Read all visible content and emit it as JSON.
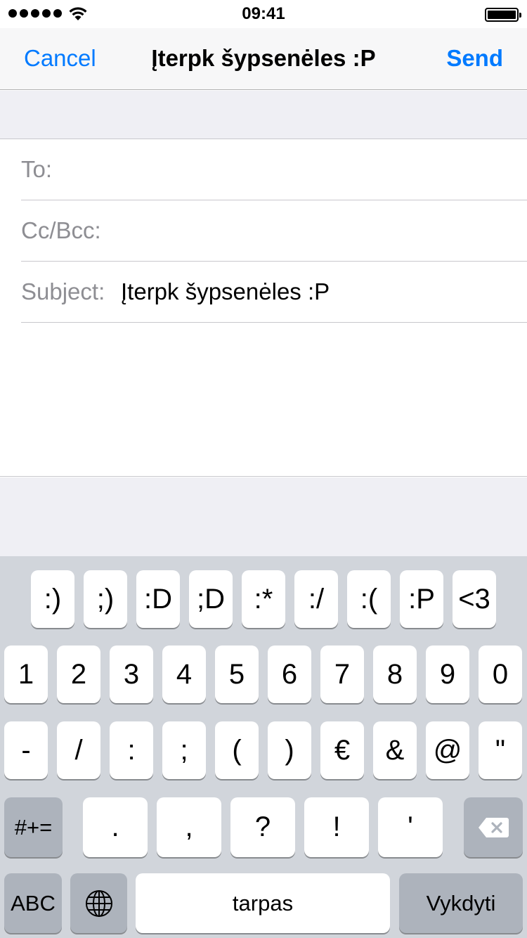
{
  "status_bar": {
    "time": "09:41",
    "signal_icon": "signal-dots-icon",
    "wifi_icon": "wifi-icon",
    "battery_icon": "battery-icon",
    "battery_level": 1.0
  },
  "nav": {
    "cancel_label": "Cancel",
    "title": "Įterpk šypsenėles :P",
    "send_label": "Send"
  },
  "fields": {
    "to_label": "To:",
    "cc_label": "Cc/Bcc:",
    "subject_label": "Subject:",
    "subject_value": "Įterpk šypsenėles :P"
  },
  "keyboard": {
    "emoticons": [
      ":)",
      ";)",
      ":D",
      ";D",
      ":*",
      ":/",
      ":(",
      ":P",
      "<3"
    ],
    "digits": [
      "1",
      "2",
      "3",
      "4",
      "5",
      "6",
      "7",
      "8",
      "9",
      "0"
    ],
    "symbols": [
      "-",
      "/",
      ":",
      ";",
      "(",
      ")",
      "€",
      "&",
      "@",
      "\""
    ],
    "row3": {
      "more_symbols_label": "#+=",
      "keys": [
        ".",
        ",",
        "?",
        "!",
        "'"
      ],
      "backspace_icon": "backspace-icon"
    },
    "row4": {
      "abc_label": "ABC",
      "globe_icon": "globe-icon",
      "space_label": "tarpas",
      "return_label": "Vykdyti"
    }
  },
  "colors": {
    "accent": "#007aff",
    "keyboard_bg": "#d1d5db",
    "key_bg": "#ffffff",
    "dark_key_bg": "#adb3bc",
    "placeholder": "#8e8e93"
  }
}
